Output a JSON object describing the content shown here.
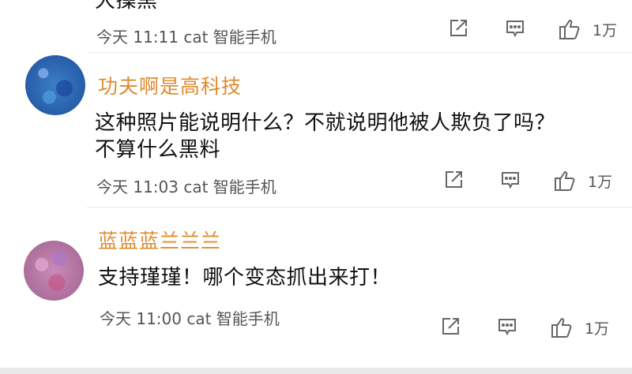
{
  "comments": [
    {
      "cut_text": "大操黑",
      "meta": "今天 11:11 cat 智能手机",
      "like_count": "1万"
    },
    {
      "author": "功夫啊是高科技",
      "text_line1": "这种照片能说明什么？不就说明他被人欺负了吗？",
      "text_line2": "不算什么黑料",
      "meta": "今天 11:03 cat 智能手机",
      "like_count": "1万"
    },
    {
      "author": "蓝蓝蓝兰兰兰",
      "text_line1": "支持瑾瑾！哪个变态抓出来打！",
      "meta": "今天 11:00 cat 智能手机",
      "like_count": "1万"
    }
  ],
  "colors": {
    "author": "#e08a2e",
    "meta": "#555555",
    "icon": "#666666"
  }
}
